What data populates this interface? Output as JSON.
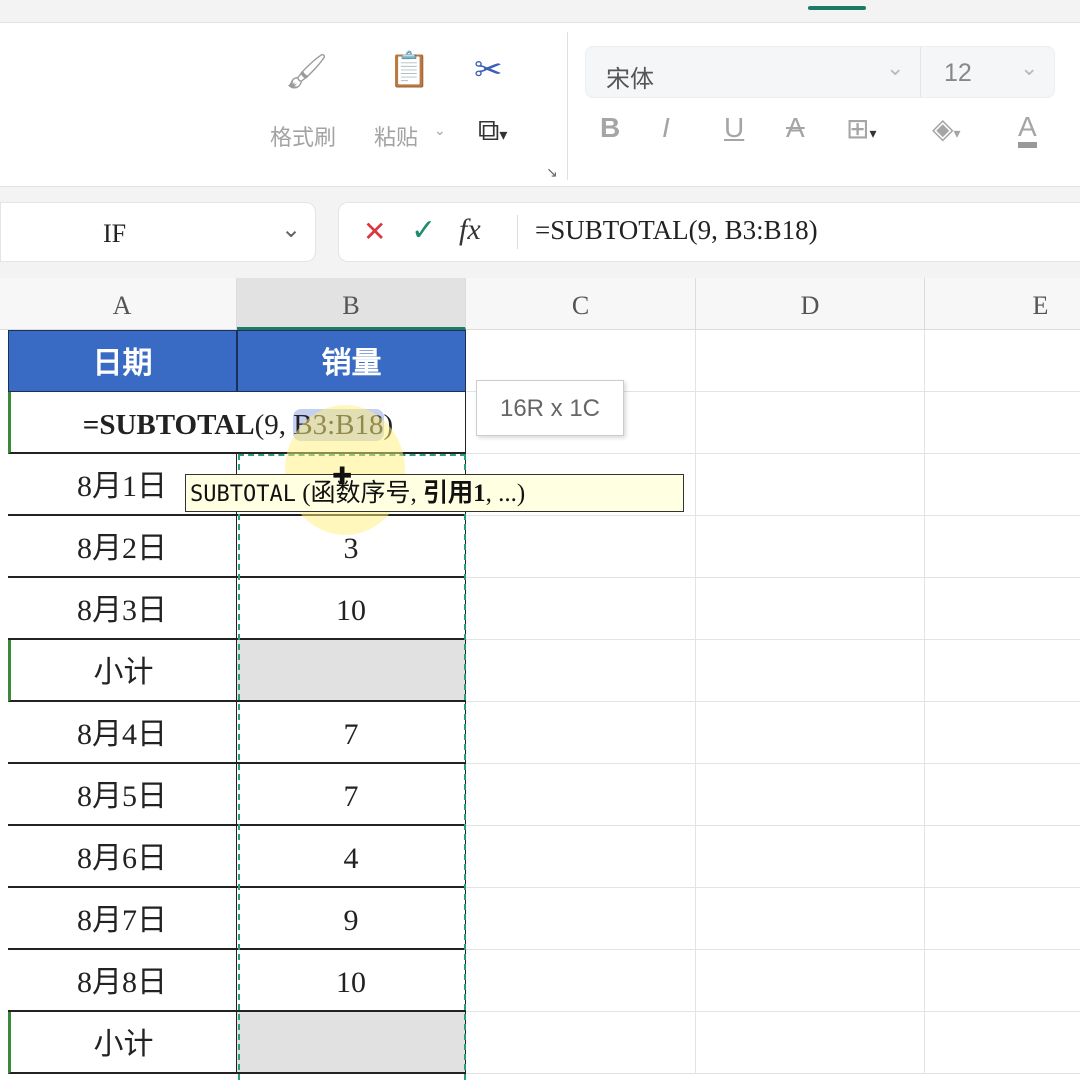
{
  "ribbon": {
    "format_painter": "格式刷",
    "paste": "粘贴",
    "font_name": "宋体",
    "font_size": "12",
    "bold": "B",
    "italic": "I",
    "underline": "U",
    "strike": "A",
    "font_color": "A"
  },
  "name_box": "IF",
  "formula_bar": {
    "cancel": "✕",
    "confirm": "✓",
    "fx": "fx",
    "formula": "=SUBTOTAL(9, B3:B18)"
  },
  "columns": [
    "A",
    "B",
    "C",
    "D",
    "E"
  ],
  "table": {
    "headers": [
      "日期",
      "销量"
    ],
    "editing_formula_prefix": "=SUBTOTAL",
    "editing_formula_args": "(9, ",
    "editing_formula_ref": "B3:B18",
    "editing_formula_suffix": ")",
    "rows": [
      {
        "date": "8月1日",
        "value": ""
      },
      {
        "date": "8月2日",
        "value": "3"
      },
      {
        "date": "8月3日",
        "value": "10"
      },
      {
        "date": "小计",
        "value": "",
        "subtotal": true
      },
      {
        "date": "8月4日",
        "value": "7"
      },
      {
        "date": "8月5日",
        "value": "7"
      },
      {
        "date": "8月6日",
        "value": "4"
      },
      {
        "date": "8月7日",
        "value": "9"
      },
      {
        "date": "8月8日",
        "value": "10"
      },
      {
        "date": "小计",
        "value": "",
        "subtotal": true
      }
    ]
  },
  "range_tooltip": "16R x 1C",
  "function_tooltip": {
    "name": "SUBTOTAL",
    "open": " (",
    "arg1": "函数序号, ",
    "arg2": "引用1",
    "rest": ", ...)"
  }
}
